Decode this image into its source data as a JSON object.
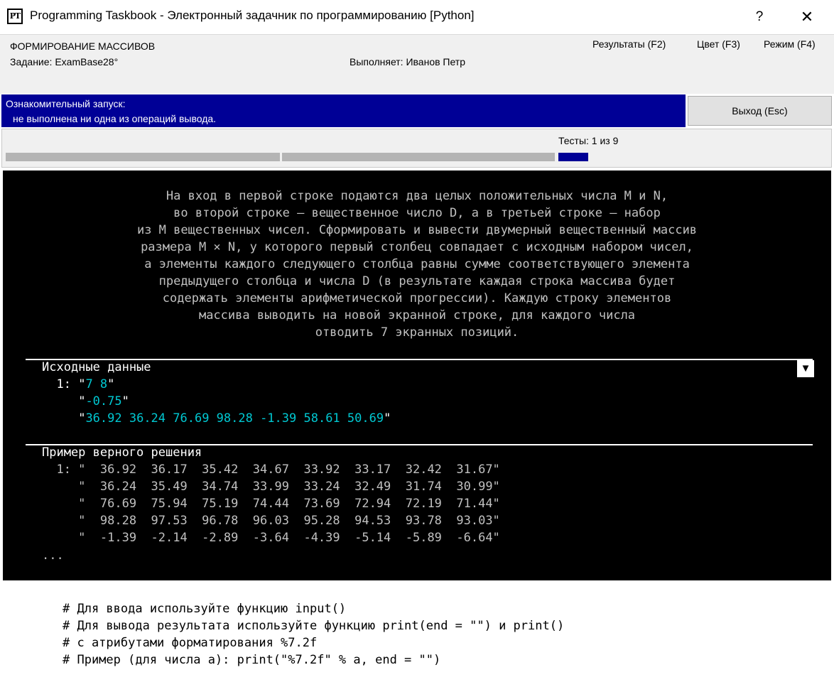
{
  "window": {
    "logo_text": "PT",
    "title": "Programming Taskbook - Электронный задачник по программированию [Python]",
    "help_symbol": "?",
    "close_symbol": "✕"
  },
  "header": {
    "task_group": "ФОРМИРОВАНИЕ МАССИВОВ",
    "task_name": "Задание: ExamBase28°",
    "performer": "Выполняет: Иванов Петр",
    "menu": [
      {
        "label": "Результаты (F2)"
      },
      {
        "label": "Цвет (F3)"
      },
      {
        "label": "Режим (F4)"
      }
    ]
  },
  "status": {
    "line1": "Ознакомительный запуск:",
    "line2": "не выполнена ни одна из операций вывода.",
    "exit_label": "Выход (Esc)"
  },
  "progress": {
    "tests_label": "Тесты:  1 из 9",
    "current_test": 1,
    "total_tests": 9
  },
  "task": {
    "description": "На вход в первой строке подаются два целых положительных числа M и N,\nво второй строке — вещественное число D, а в третьей строке — набор\nиз M вещественных чисел. Сформировать и вывести двумерный вещественный массив\nразмера M × N, у которого первый столбец совпадает с исходным набором чисел,\nа элементы каждого следующего столбца равны сумме соответствующего элемента\nпредыдущего столбца и числа D (в результате каждая строка массива будет\nсодержать элементы арифметической прогрессии). Каждую строку элементов\nмассива выводить на новой экранной строке, для каждого числа\nотводить 7 экранных позиций.",
    "input_title": "Исходные данные",
    "dropdown_symbol": "▼",
    "input_lines": [
      {
        "prefix": "  1: ",
        "value": "7 8"
      },
      {
        "prefix": "     ",
        "value": "-0.75"
      },
      {
        "prefix": "     ",
        "value": "36.92 36.24 76.69 98.28 -1.39 58.61 50.69"
      }
    ],
    "example_title": "Пример верного решения",
    "example_lines": [
      "  1: \"  36.92  36.17  35.42  34.67  33.92  33.17  32.42  31.67\"",
      "     \"  36.24  35.49  34.74  33.99  33.24  32.49  31.74  30.99\"",
      "     \"  76.69  75.94  75.19  74.44  73.69  72.94  72.19  71.44\"",
      "     \"  98.28  97.53  96.78  96.03  95.28  94.53  93.78  93.03\"",
      "     \"  -1.39  -2.14  -2.89  -3.64  -4.39  -5.14  -5.89  -6.64\""
    ],
    "ellipsis": "..."
  },
  "code_hint": [
    "# Для ввода используйте функцию input()",
    "# Для вывода результата используйте функцию print(end = \"\") и print()",
    "# с атрибутами форматирования %7.2f",
    "# Пример (для числа a): print(\"%7.2f\" % a, end = \"\")"
  ]
}
